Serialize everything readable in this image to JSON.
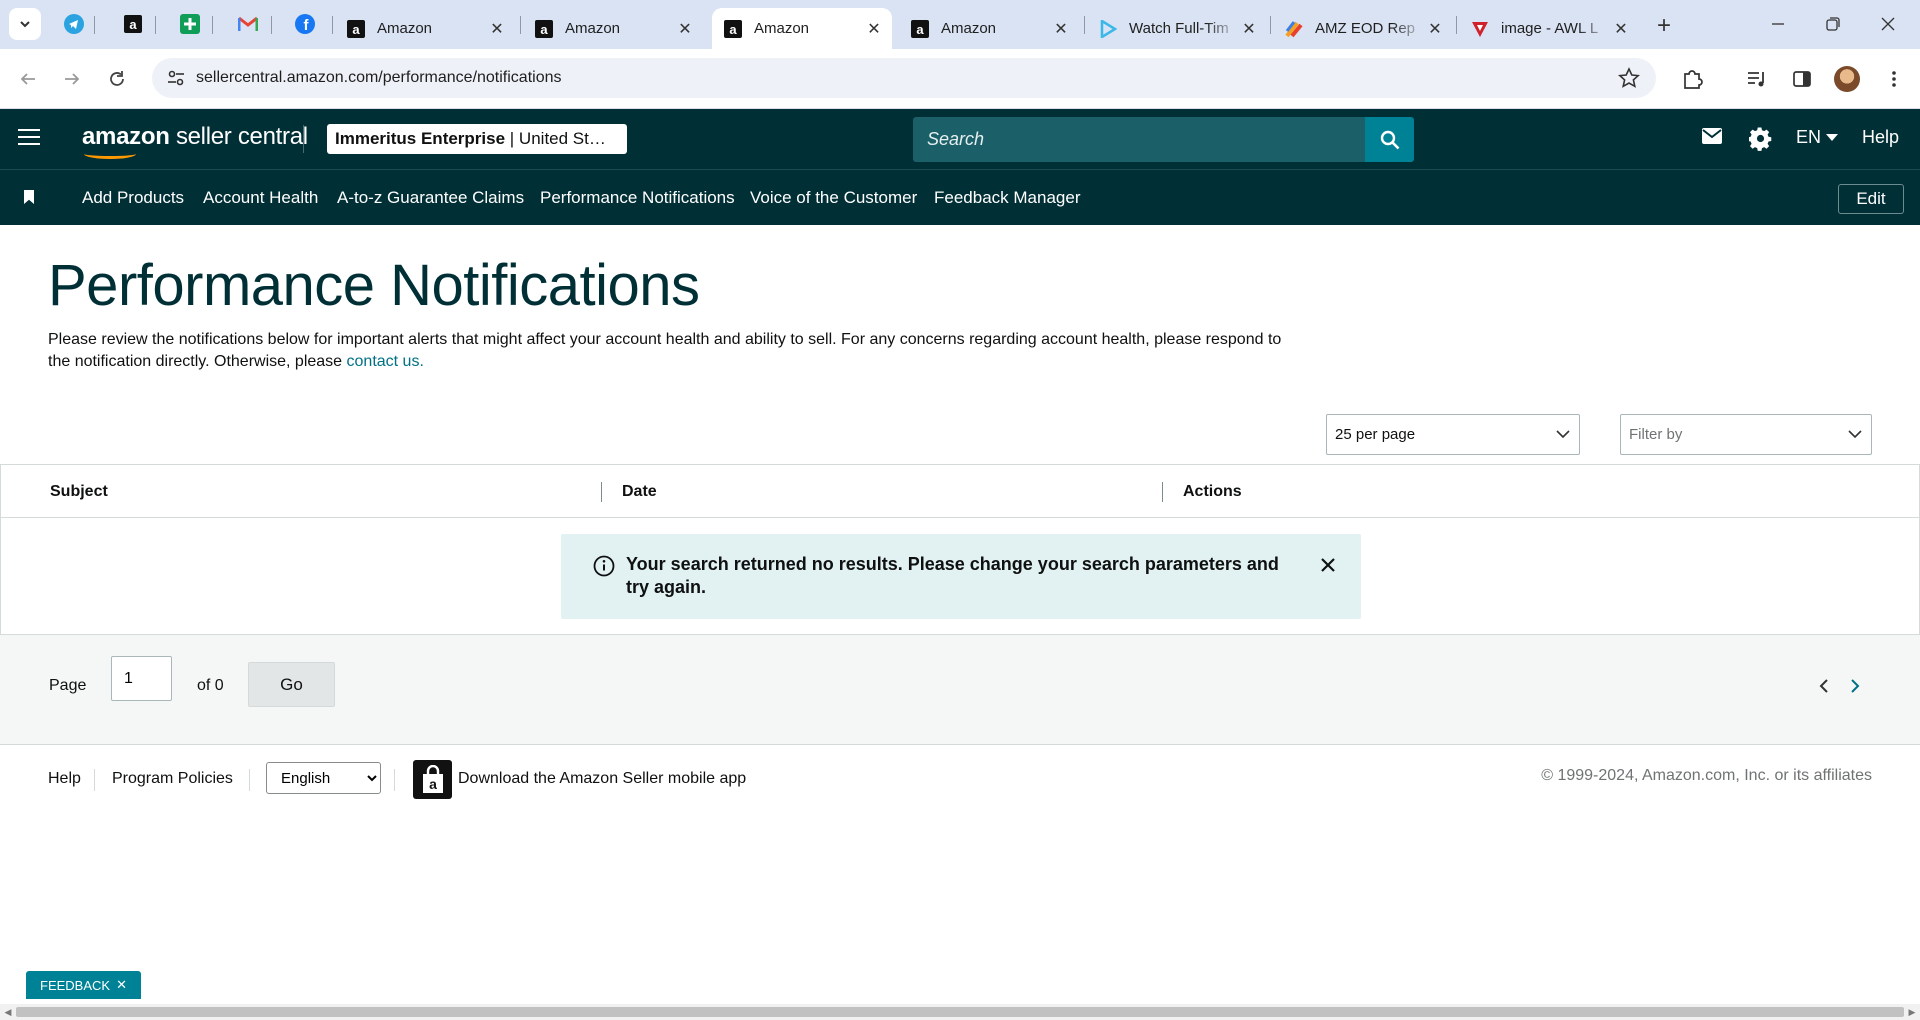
{
  "browser": {
    "tabs": [
      {
        "title": "Amazon",
        "favicon": "amazon-icon"
      },
      {
        "title": "Amazon",
        "favicon": "amazon-icon"
      },
      {
        "title": "Amazon",
        "favicon": "amazon-icon",
        "active": true
      },
      {
        "title": "Amazon",
        "favicon": "amazon-icon"
      },
      {
        "title": "Watch Full-Tim",
        "favicon": "play-icon"
      },
      {
        "title": "AMZ EOD Rep",
        "favicon": "brush-icon"
      },
      {
        "title": "image - AWL L",
        "favicon": "awl-icon"
      }
    ],
    "pinned_tabs": [
      "telegram-icon",
      "amazon-icon",
      "sheets-icon",
      "gmail-icon",
      "facebook-icon"
    ],
    "url": "sellercentral.amazon.com/performance/notifications"
  },
  "header": {
    "logo_word1": "amazon",
    "logo_word2": "seller central",
    "store_name": "Immeritus Enterprise",
    "store_region": "| United St…",
    "search_placeholder": "Search",
    "language": "EN",
    "help_label": "Help"
  },
  "nav": {
    "items": [
      "Add Products",
      "Account Health",
      "A-to-z Guarantee Claims",
      "Performance Notifications",
      "Voice of the Customer",
      "Feedback Manager"
    ],
    "edit_label": "Edit"
  },
  "main": {
    "title": "Performance Notifications",
    "intro_text": "Please review the notifications below for important alerts that might affect your account health and ability to sell. For any concerns regarding account health, please respond to the notification directly. Otherwise, please ",
    "intro_link": "contact us.",
    "per_page": "25 per page",
    "filter_placeholder": "Filter by",
    "table": {
      "columns": [
        "Subject",
        "Date",
        "Actions"
      ]
    },
    "alert_text": "Your search returned no results. Please change your search parameters and try again.",
    "pager": {
      "page_label": "Page",
      "page_value": "1",
      "of_label": "of 0",
      "go_label": "Go"
    }
  },
  "footer": {
    "help": "Help",
    "program_policies": "Program Policies",
    "language_option": "English",
    "app_text": "Download the Amazon Seller mobile app",
    "copyright": "© 1999-2024, Amazon.com, Inc. or its affiliates"
  },
  "feedback_label": "FEEDBACK",
  "colors": {
    "header_bg": "#002f36",
    "accent": "#008296",
    "link": "#007185",
    "alert_bg": "#e2f1f1",
    "tabstrip_bg": "#dae3f3"
  }
}
